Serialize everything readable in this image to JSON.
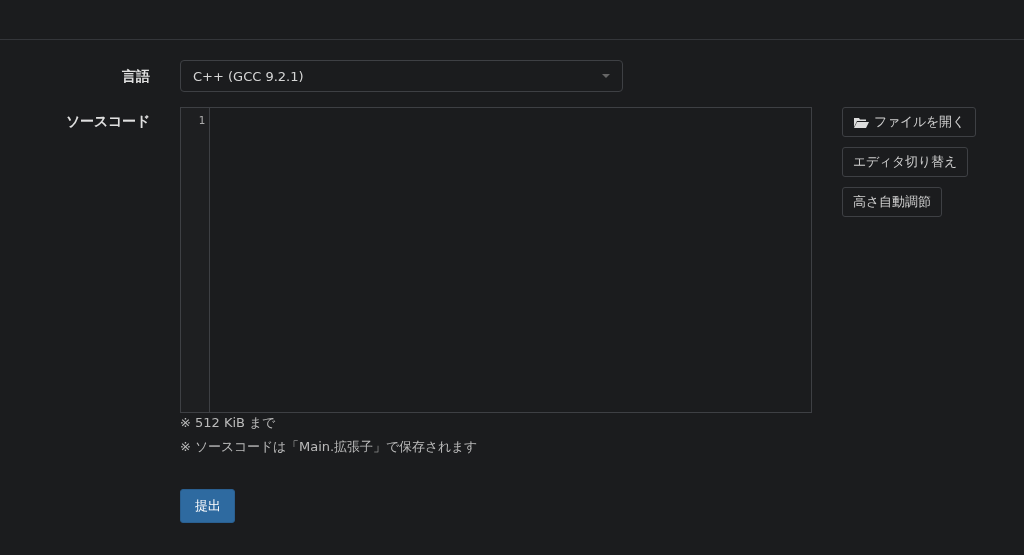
{
  "language_field": {
    "label": "言語",
    "value": "C++ (GCC 9.2.1)"
  },
  "source_field": {
    "label": "ソースコード",
    "line_numbers": [
      "1"
    ]
  },
  "side_buttons": [
    {
      "kind": "folder",
      "label": "ファイルを開く"
    },
    {
      "kind": "plain",
      "label": "エディタ切り替え"
    },
    {
      "kind": "plain",
      "label": "高さ自動調節"
    }
  ],
  "notes": [
    "※ 512 KiB まで",
    "※ ソースコードは「Main.拡張子」で保存されます"
  ],
  "submit_button": {
    "label": "提出"
  }
}
